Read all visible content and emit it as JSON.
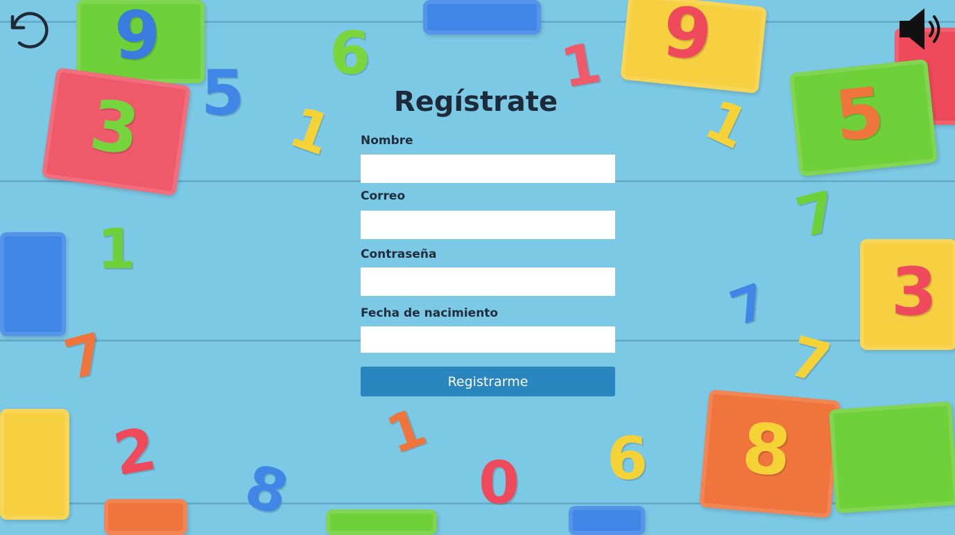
{
  "nav": {
    "back_icon": "undo-icon",
    "sound_icon": "speaker-volume-icon"
  },
  "form": {
    "title": "Regístrate",
    "fields": [
      {
        "label": "Nombre",
        "value": "",
        "placeholder": ""
      },
      {
        "label": "Correo",
        "value": "",
        "placeholder": ""
      },
      {
        "label": "Contraseña",
        "value": "",
        "placeholder": ""
      },
      {
        "label": "Fecha de nacimiento",
        "value": "",
        "placeholder": ""
      }
    ],
    "submit_label": "Registrarme"
  },
  "colors": {
    "background": "#7cc9e6",
    "button": "#2a86bf",
    "title": "#1c2a3a"
  }
}
